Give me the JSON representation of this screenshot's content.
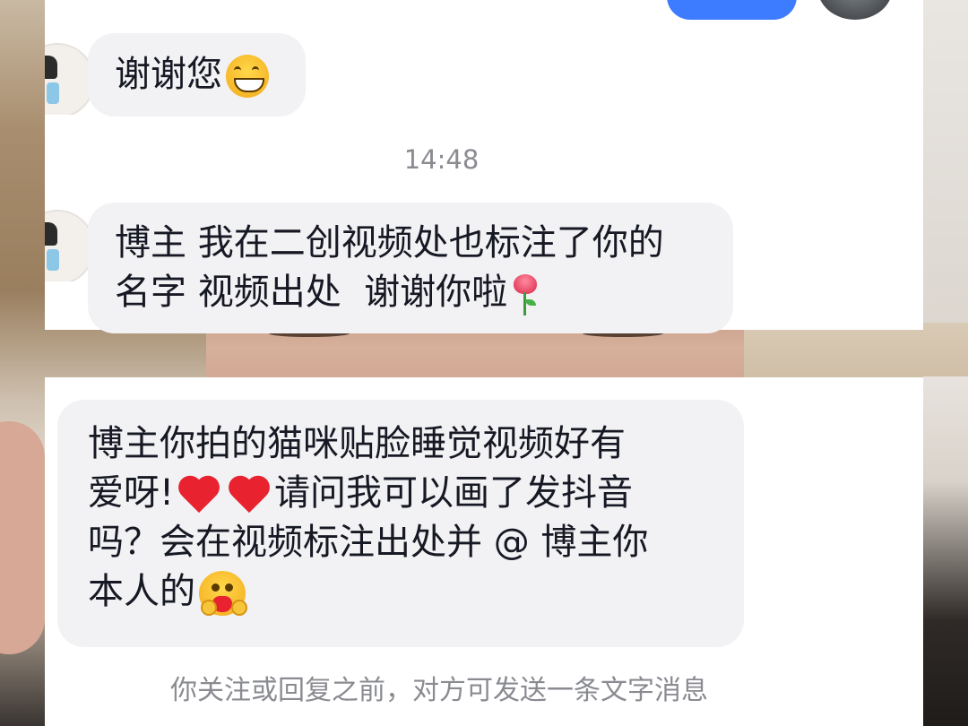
{
  "conversation": {
    "messages": [
      {
        "text": "谢谢您",
        "emoji": "grinning-face-icon"
      },
      {
        "line1": "博主 我在二创视频处也标注了你的",
        "line2": "名字 视频出处  谢谢你啦",
        "emoji": "rose-icon"
      },
      {
        "line1": "博主你拍的猫咪贴脸睡觉视频好有",
        "line2a": "爱呀!",
        "line2b": "请问我可以画了发抖音",
        "line3": "吗？会在视频标注出处并 @ 博主你",
        "line4": "本人的",
        "emojis": [
          "red-heart-icon",
          "red-heart-icon",
          "hugging-face-icon"
        ]
      }
    ],
    "timestamp": "14:48",
    "footer_note": "你关注或回复之前，对方可发送一条文字消息"
  },
  "colors": {
    "bubble_received": "#f2f2f4",
    "bubble_sent": "#3d7bff",
    "text_primary": "#161823",
    "text_secondary": "#8a8b91"
  }
}
